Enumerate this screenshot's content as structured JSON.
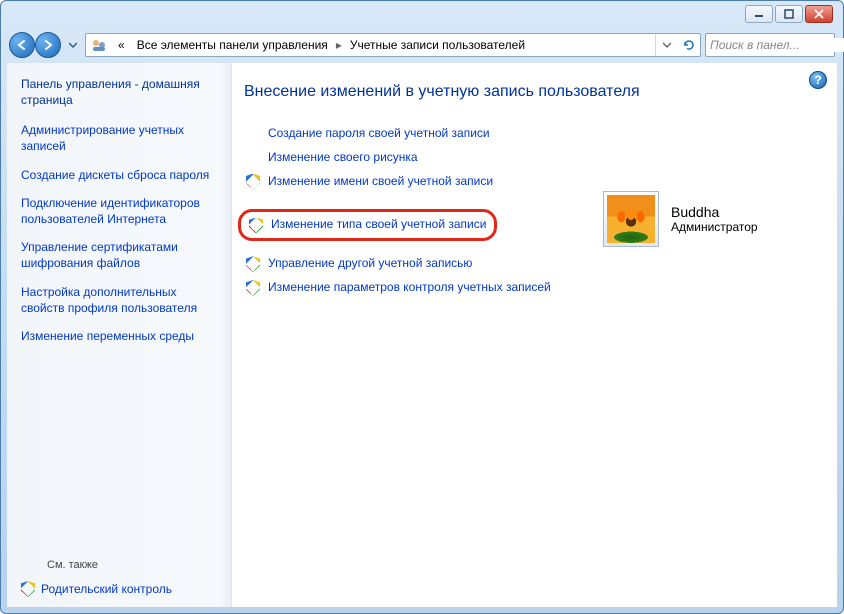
{
  "window": {
    "breadcrumb": {
      "seg0": "«",
      "seg1": "Все элементы панели управления",
      "seg2": "Учетные записи пользователей"
    },
    "search_placeholder": "Поиск в панел..."
  },
  "sidebar": {
    "home": "Панель управления - домашняя страница",
    "links": [
      "Администрирование учетных записей",
      "Создание дискеты сброса пароля",
      "Подключение идентификаторов пользователей Интернета",
      "Управление сертификатами шифрования файлов",
      "Настройка дополнительных свойств профиля пользователя",
      "Изменение переменных среды"
    ],
    "see_also_hdr": "См. также",
    "see_also_link": "Родительский контроль"
  },
  "content": {
    "header": "Внесение изменений в учетную запись пользователя",
    "actions_top": [
      "Создание пароля своей учетной записи",
      "Изменение своего рисунка",
      "Изменение имени своей учетной записи"
    ],
    "highlighted": "Изменение типа своей учетной записи",
    "actions_bottom": [
      "Управление другой учетной записью",
      "Изменение параметров контроля учетных записей"
    ],
    "user": {
      "name": "Buddha",
      "role": "Администратор"
    },
    "help": "?"
  }
}
